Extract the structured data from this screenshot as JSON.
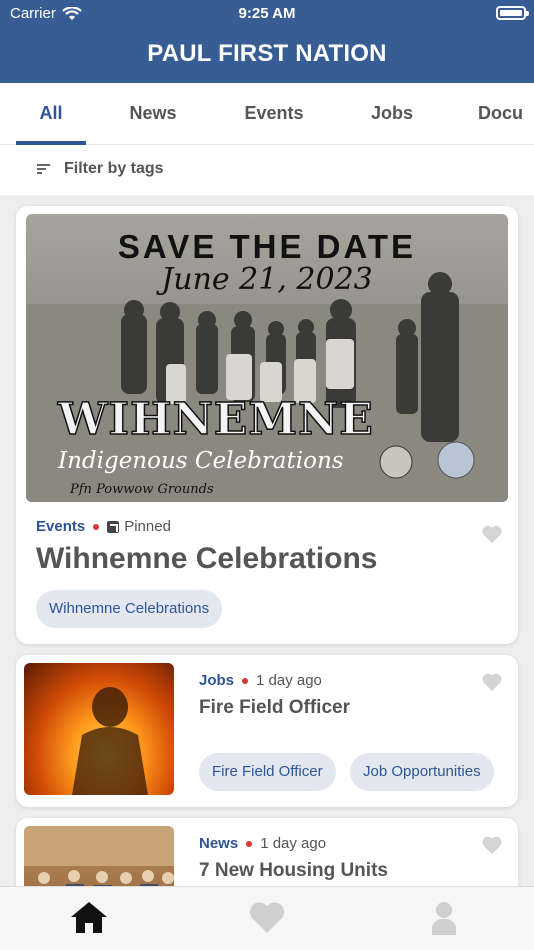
{
  "status_bar": {
    "carrier": "Carrier",
    "time": "9:25 AM"
  },
  "header": {
    "title": "PAUL FIRST NATION"
  },
  "tabs": [
    {
      "label": "All",
      "active": true
    },
    {
      "label": "News",
      "active": false
    },
    {
      "label": "Events",
      "active": false
    },
    {
      "label": "Jobs",
      "active": false
    },
    {
      "label": "Docu",
      "active": false
    }
  ],
  "filter": {
    "label": "Filter by tags"
  },
  "feed": [
    {
      "category": "Events",
      "pinned_label": "Pinned",
      "title": "Wihnemne Celebrations",
      "tags": [
        "Wihnemne Celebrations"
      ],
      "poster": {
        "headline": "SAVE THE DATE",
        "date": "June 21, 2023",
        "name": "WIHNEMNE",
        "subtitle": "Indigenous Celebrations",
        "location": "Pfn Powwow Grounds"
      }
    },
    {
      "category": "Jobs",
      "time_ago": "1 day ago",
      "title": "Fire Field Officer",
      "tags": [
        "Fire Field Officer",
        "Job Opportunities"
      ]
    },
    {
      "category": "News",
      "time_ago": "1 day ago",
      "title": "7 New Housing Units",
      "tags": []
    }
  ],
  "bottom_nav": {
    "items": [
      "home-icon",
      "heart-icon",
      "profile-icon"
    ],
    "active": "home-icon"
  },
  "colors": {
    "brand": "#385c94",
    "accent": "#2f5597",
    "dot": "#dd3333",
    "chip_bg": "#e3e7ef"
  }
}
